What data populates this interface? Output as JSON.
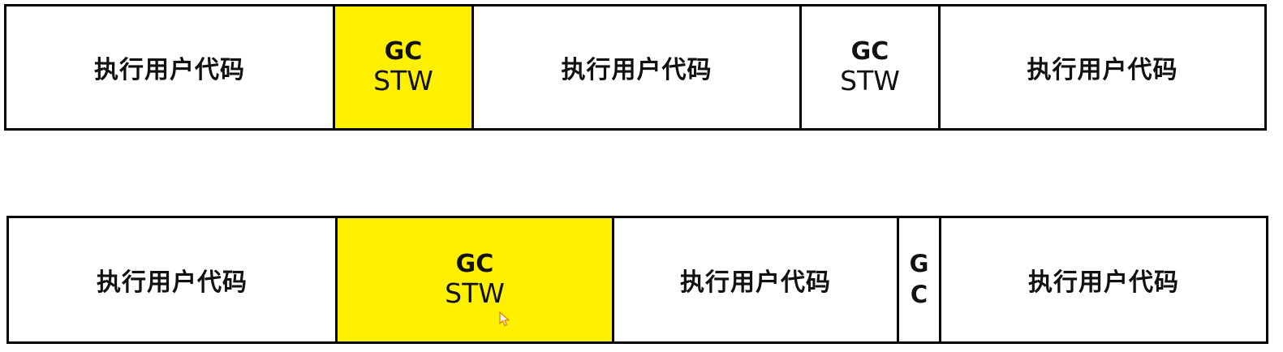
{
  "colors": {
    "highlight": "#fff000",
    "border": "#000000",
    "background": "#ffffff"
  },
  "rows": [
    {
      "segments": [
        {
          "kind": "code",
          "label": "执行用户代码"
        },
        {
          "kind": "gc",
          "gc": "GC",
          "stw": "STW",
          "highlighted": true
        },
        {
          "kind": "code",
          "label": "执行用户代码"
        },
        {
          "kind": "gc",
          "gc": "GC",
          "stw": "STW",
          "highlighted": false
        },
        {
          "kind": "code",
          "label": "执行用户代码"
        }
      ]
    },
    {
      "segments": [
        {
          "kind": "code",
          "label": "执行用户代码"
        },
        {
          "kind": "gc",
          "gc": "GC",
          "stw": "STW",
          "highlighted": true
        },
        {
          "kind": "code",
          "label": "执行用户代码"
        },
        {
          "kind": "gc-narrow",
          "gc": "GC",
          "highlighted": false
        },
        {
          "kind": "code",
          "label": "执行用户代码"
        }
      ]
    }
  ],
  "cursor_icon": "mouse-pointer-icon"
}
